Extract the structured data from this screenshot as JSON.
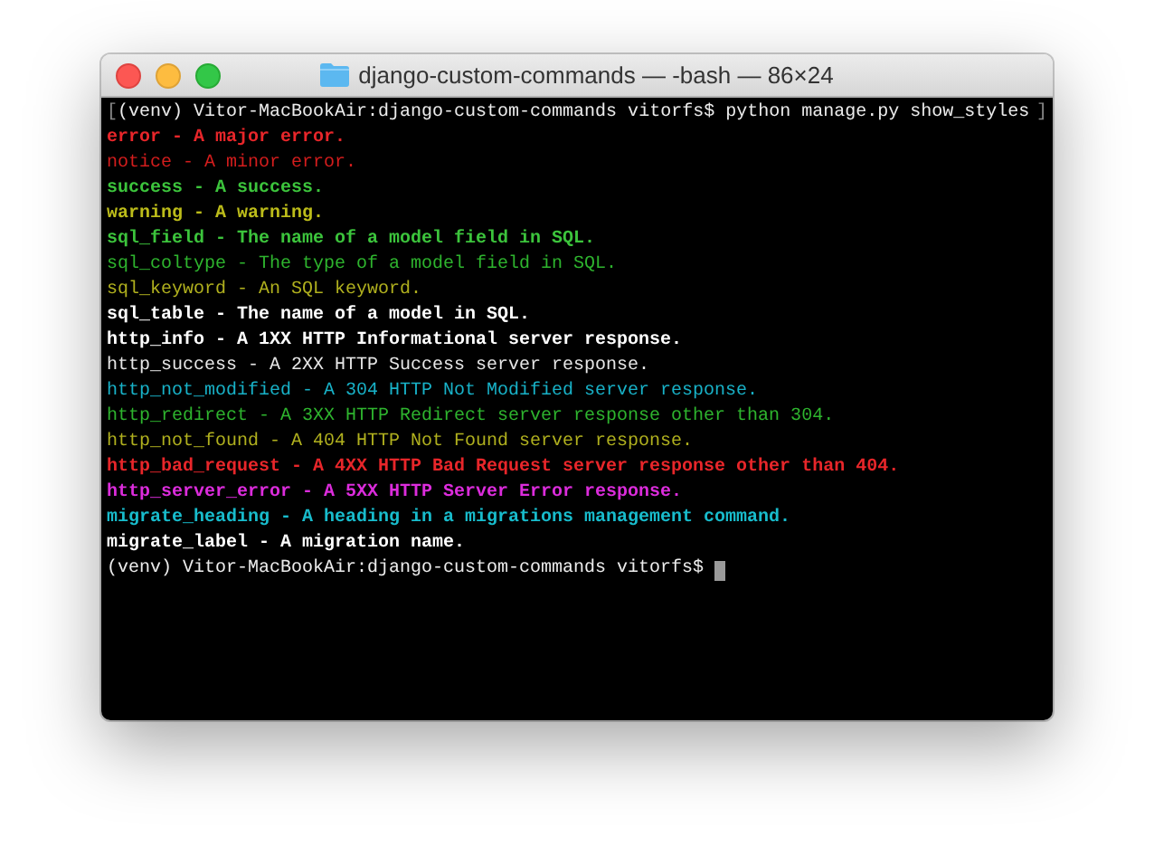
{
  "window": {
    "title": "django-custom-commands — -bash — 86×24"
  },
  "lines": [
    {
      "kind": "command",
      "open_mark": "[",
      "text": "(venv) Vitor-MacBookAir:django-custom-commands vitorfs$ python manage.py show_styles",
      "close_mark": "]"
    },
    {
      "kind": "output",
      "text": "error - A major error.",
      "color": "#e8262a",
      "bold": true
    },
    {
      "kind": "output",
      "text": "notice - A minor error.",
      "color": "#d41d1d",
      "bold": false
    },
    {
      "kind": "output",
      "text": "success - A success.",
      "color": "#3cc43c",
      "bold": true
    },
    {
      "kind": "output",
      "text": "warning - A warning.",
      "color": "#bcbc1a",
      "bold": true
    },
    {
      "kind": "output",
      "text": "sql_field - The name of a model field in SQL.",
      "color": "#3cc43c",
      "bold": true
    },
    {
      "kind": "output",
      "text": "sql_coltype - The type of a model field in SQL.",
      "color": "#2eb42e",
      "bold": false
    },
    {
      "kind": "output",
      "text": "sql_keyword - An SQL keyword.",
      "color": "#b0b01e",
      "bold": false
    },
    {
      "kind": "output",
      "text": "sql_table - The name of a model in SQL.",
      "color": "#ffffff",
      "bold": true
    },
    {
      "kind": "output",
      "text": "http_info - A 1XX HTTP Informational server response.",
      "color": "#ffffff",
      "bold": true
    },
    {
      "kind": "output",
      "text": "http_success - A 2XX HTTP Success server response.",
      "color": "#e6e6e6",
      "bold": false
    },
    {
      "kind": "output",
      "text": "http_not_modified - A 304 HTTP Not Modified server response.",
      "color": "#18b2c8",
      "bold": false
    },
    {
      "kind": "output",
      "text": "http_redirect - A 3XX HTTP Redirect server response other than 304.",
      "color": "#2eb42e",
      "bold": false
    },
    {
      "kind": "output",
      "text": "http_not_found - A 404 HTTP Not Found server response.",
      "color": "#b0b01e",
      "bold": false
    },
    {
      "kind": "output",
      "text": "http_bad_request - A 4XX HTTP Bad Request server response other than 404.",
      "color": "#e8262a",
      "bold": true
    },
    {
      "kind": "output",
      "text": "http_server_error - A 5XX HTTP Server Error response.",
      "color": "#dc2cdc",
      "bold": true
    },
    {
      "kind": "output",
      "text": "migrate_heading - A heading in a migrations management command.",
      "color": "#18bccc",
      "bold": true
    },
    {
      "kind": "output",
      "text": "migrate_label - A migration name.",
      "color": "#ffffff",
      "bold": true
    },
    {
      "kind": "prompt",
      "text": "(venv) Vitor-MacBookAir:django-custom-commands vitorfs$",
      "cursor": true
    }
  ]
}
